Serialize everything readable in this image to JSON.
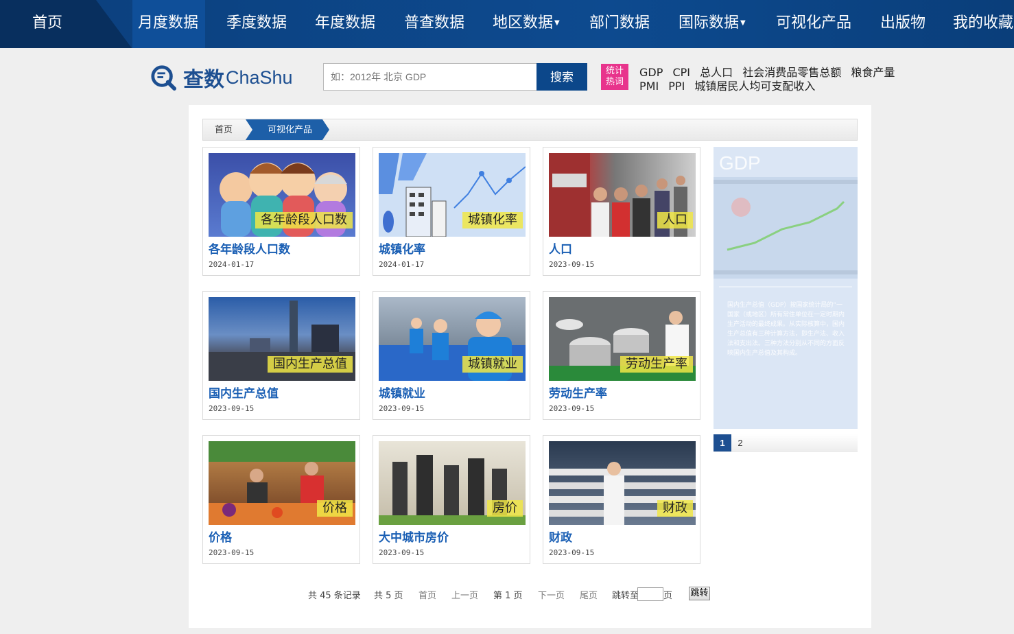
{
  "nav": {
    "home": "首页",
    "items": [
      "月度数据",
      "季度数据",
      "年度数据",
      "普查数据",
      "地区数据",
      "部门数据",
      "国际数据",
      "可视化产品",
      "出版物",
      "我的收藏"
    ]
  },
  "header": {
    "logo_cn": "查数",
    "logo_en": "ChaShu",
    "search_placeholder": "如：2012年 北京 GDP",
    "search_button": "搜索",
    "hot_badge_line1": "统计",
    "hot_badge_line2": "热词",
    "hot_row1": [
      "GDP",
      "CPI",
      "总人口",
      "社会消费品零售总额",
      "粮食产量"
    ],
    "hot_row2": [
      "PMI",
      "PPI",
      "城镇居民人均可支配收入"
    ]
  },
  "breadcrumb": {
    "home": "首页",
    "current": "可视化产品"
  },
  "cards": [
    {
      "label": "各年龄段人口数",
      "title": "各年龄段人口数",
      "date": "2024-01-17"
    },
    {
      "label": "城镇化率",
      "title": "城镇化率",
      "date": "2024-01-17"
    },
    {
      "label": "人口",
      "title": "人口",
      "date": "2023-09-15"
    },
    {
      "label": "国内生产总值",
      "title": "国内生产总值",
      "date": "2023-09-15"
    },
    {
      "label": "城镇就业",
      "title": "城镇就业",
      "date": "2023-09-15"
    },
    {
      "label": "劳动生产率",
      "title": "劳动生产率",
      "date": "2023-09-15"
    },
    {
      "label": "价格",
      "title": "价格",
      "date": "2023-09-15"
    },
    {
      "label": "房价",
      "title": "大中城市房价",
      "date": "2023-09-15"
    },
    {
      "label": "财政",
      "title": "财政",
      "date": "2023-09-15"
    }
  ],
  "sidebar": {
    "heading": "GDP",
    "text": "国内生产总值（GDP）按国家统计局的“一国家（或地区）所有常住单位在一定时期内生产活动的最终成果。从实际核算中，国内生产总值有三种计算方法，即生产法、收入法和支出法。三种方法分别从不同的方面反映国内生产总值及其构成。",
    "pages": [
      "1",
      "2"
    ]
  },
  "pager": {
    "total_records": "共 45 条记录",
    "total_pages": "共 5 页",
    "first": "首页",
    "prev": "上一页",
    "current": "第 1 页",
    "next": "下一页",
    "last": "尾页",
    "jump_to": "跳转至",
    "page_unit": "页",
    "jump_button": "跳转"
  },
  "colors": {
    "nav_bg": "#0d4a8f",
    "accent": "#1d5fa8",
    "title_link": "#1a5fb4",
    "hot_badge": "#e8348c"
  }
}
